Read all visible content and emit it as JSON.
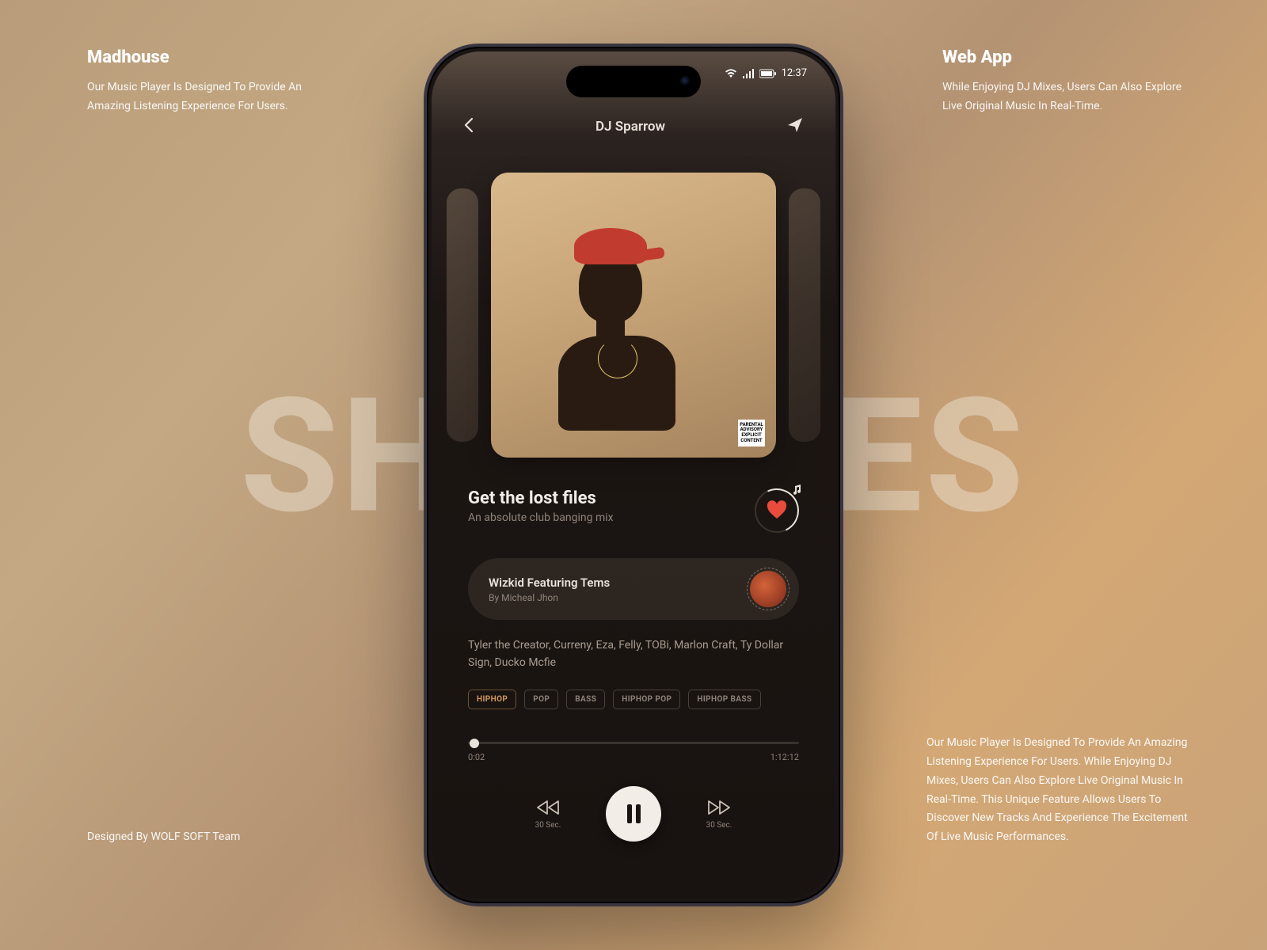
{
  "bg_word": "SHUFFLES",
  "top_left": {
    "heading": "Madhouse",
    "body": "Our Music Player Is Designed To Provide An Amazing Listening Experience For Users."
  },
  "top_right": {
    "heading": "Web App",
    "body": "While Enjoying DJ Mixes, Users Can Also Explore Live Original Music In Real-Time."
  },
  "bottom_right": {
    "body": "Our Music Player Is Designed To Provide An Amazing Listening Experience For Users. While Enjoying DJ Mixes, Users Can Also Explore Live Original Music In Real-Time. This Unique Feature Allows Users To Discover New Tracks And Experience The Excitement Of Live Music Performances."
  },
  "bottom_left": {
    "body": "Designed By WOLF SOFT Team"
  },
  "status": {
    "time": "12:37"
  },
  "nav": {
    "title": "DJ Sparrow"
  },
  "album": {
    "pa_label": "PARENTAL ADVISORY EXPLICIT CONTENT"
  },
  "track": {
    "title": "Get the lost files",
    "subtitle": "An absolute club banging mix"
  },
  "featuring": {
    "line1": "Wizkid Featuring Tems",
    "line2": "By Micheal Jhon"
  },
  "credits": "Tyler the Creator, Curreny, Eza, Felly, TOBi, Marlon Craft, Ty Dollar Sign, Ducko Mcfie",
  "tags": [
    "HIPHOP",
    "POP",
    "BASS",
    "HIPHOP POP",
    "HIPHOP BASS"
  ],
  "progress": {
    "elapsed": "0:02",
    "total": "1:12:12",
    "percent": 2
  },
  "controls": {
    "skip_label": "30 Sec."
  }
}
